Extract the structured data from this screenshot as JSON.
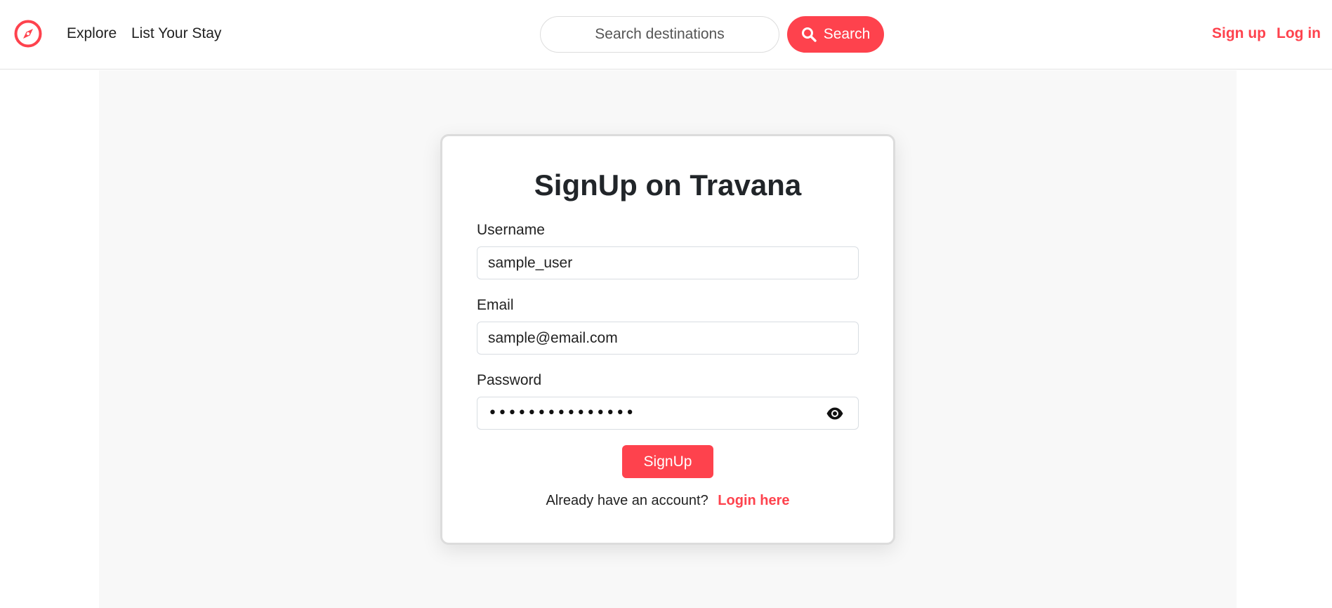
{
  "nav": {
    "logo_icon": "compass-icon",
    "explore": "Explore",
    "list_your_stay": "List Your Stay",
    "search_placeholder": "Search destinations",
    "search_button": "Search",
    "search_icon": "search-icon",
    "signup": "Sign up",
    "login": "Log in"
  },
  "card": {
    "title": "SignUp on Travana",
    "username_label": "Username",
    "username_value": "sample_user",
    "email_label": "Email",
    "email_value": "sample@email.com",
    "password_label": "Password",
    "password_masked": "•••••••••••••••",
    "password_toggle_icon": "eye-icon",
    "signup_button": "SignUp",
    "login_prompt": "Already have an account?",
    "login_link": "Login here"
  },
  "colors": {
    "accent": "#fe424d",
    "background": "#f8f8f8",
    "card": "#ffffff"
  }
}
